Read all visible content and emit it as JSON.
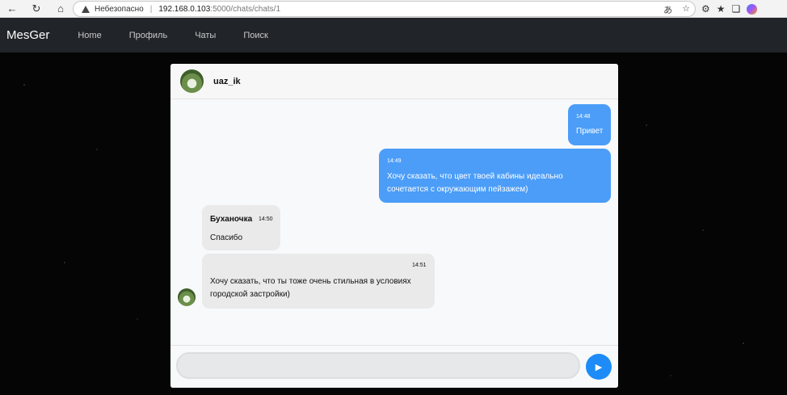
{
  "browser": {
    "security_warning": "Небезопасно",
    "url_host": "192.168.0.103",
    "url_path": ":5000/chats/chats/1",
    "icons": [
      "back-icon",
      "refresh-icon",
      "home-icon",
      "warning-icon",
      "translate-icon",
      "star-icon",
      "extensions-icon",
      "favorites-icon",
      "collections-icon",
      "copilot-icon"
    ]
  },
  "nav": {
    "brand": "MesGer",
    "links": [
      "Home",
      "Профиль",
      "Чаты",
      "Поиск"
    ]
  },
  "chat": {
    "partner_name": "uaz_ik",
    "messages": [
      {
        "direction": "out",
        "time": "14:48",
        "text": "Привет"
      },
      {
        "direction": "out",
        "time": "14:49",
        "text_lines": [
          "Хочу сказать, что цвет твоей кабины идеально",
          "сочетается с окружающим пейзажем)"
        ]
      },
      {
        "direction": "in",
        "sender": "Буханочка",
        "time": "14:50",
        "text": "Спасибо"
      },
      {
        "direction": "in",
        "time": "14:51",
        "text_lines": [
          "Хочу сказать, что ты тоже очень стильная в условиях",
          "городской застройки)"
        ]
      }
    ],
    "input_value": "",
    "send_icon": "send-icon"
  },
  "colors": {
    "navbar": "#212529",
    "outgoing_bubble": "#4b9df8",
    "incoming_bubble": "#eaeaea",
    "send_button": "#1d8cf8"
  }
}
